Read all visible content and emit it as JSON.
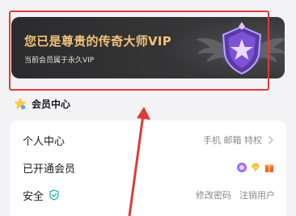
{
  "vip_card": {
    "title": "您已是尊贵的传奇大师VIP",
    "subtitle": "当前会员属于永久VIP",
    "badge_icon": "legend-master-badge-icon"
  },
  "section": {
    "title": "会员中心",
    "icon": "star-icon"
  },
  "list": {
    "rows": [
      {
        "label": "个人中心",
        "right_text": "手机 邮箱 特权",
        "right_icon": "chevron-right-icon"
      },
      {
        "label": "已开通会员",
        "right_icons": [
          "purple-vip-icon",
          "diamond-icon",
          "gift-icon"
        ]
      },
      {
        "label": "安全",
        "label_icon": "shield-check-icon",
        "action_1": "修改密码",
        "action_2": "注销用户"
      }
    ]
  },
  "colors": {
    "vip_title": "#f2c27a",
    "annotation": "#e03a35",
    "shield": "#28b3b3"
  }
}
